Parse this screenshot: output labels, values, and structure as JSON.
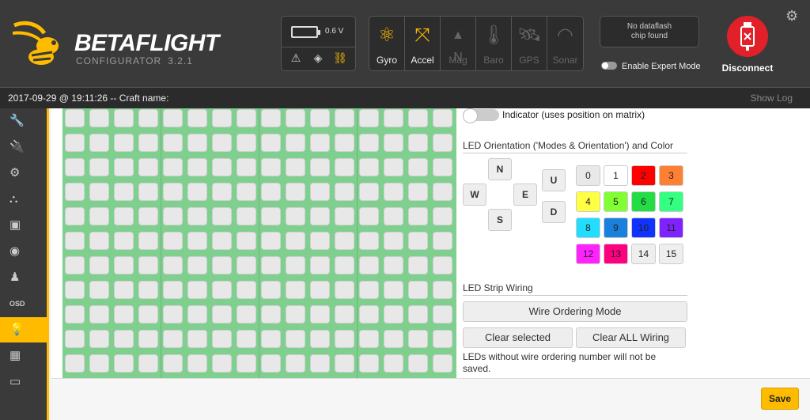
{
  "app": {
    "brand": "BETAFLIGHT",
    "subtitle": "CONFIGURATOR",
    "version": "3.2.1"
  },
  "battery": {
    "voltage": "0.6 V",
    "icons": [
      "warning-icon",
      "diamond-icon",
      "link-icon"
    ]
  },
  "sensors": [
    {
      "label": "Gyro",
      "state": "on"
    },
    {
      "label": "Accel",
      "state": "on"
    },
    {
      "label": "Mag",
      "state": "off"
    },
    {
      "label": "Baro",
      "state": "off"
    },
    {
      "label": "GPS",
      "state": "off"
    },
    {
      "label": "Sonar",
      "state": "off"
    }
  ],
  "dataflash": {
    "line1": "No dataflash",
    "line2": "chip found"
  },
  "expert_mode": {
    "label": "Enable Expert Mode"
  },
  "connection": {
    "disconnect_label": "Disconnect"
  },
  "status": {
    "time_text": "2017-09-29 @ 19:11:26 -- Craft name:",
    "show_log": "Show Log"
  },
  "sidebar": {
    "items": [
      {
        "name": "setup",
        "icon": "wrench-icon"
      },
      {
        "name": "ports",
        "icon": "plug-icon"
      },
      {
        "name": "configuration",
        "icon": "gear-icon"
      },
      {
        "name": "failsafe",
        "icon": "tree-icon"
      },
      {
        "name": "receiver",
        "icon": "robot-icon"
      },
      {
        "name": "modes",
        "icon": "toggle-icon"
      },
      {
        "name": "motors",
        "icon": "motor-icon"
      },
      {
        "name": "osd",
        "icon": "osd-icon"
      },
      {
        "name": "led-strip",
        "icon": "bulb-icon",
        "active": true
      },
      {
        "name": "blackbox",
        "icon": "chip-icon"
      },
      {
        "name": "cli",
        "icon": "terminal-icon"
      }
    ]
  },
  "led_grid": {
    "rows": 11,
    "cols": 16
  },
  "indicator": {
    "label": "Indicator (uses position on matrix)"
  },
  "orientation": {
    "title": "LED Orientation ('Modes & Orientation') and Color",
    "directions": [
      "N",
      "W",
      "E",
      "S",
      "U",
      "D"
    ],
    "colors": [
      {
        "label": "0",
        "hex": "#e8e8e8"
      },
      {
        "label": "1",
        "hex": "#ffffff"
      },
      {
        "label": "2",
        "hex": "#ff0000"
      },
      {
        "label": "3",
        "hex": "#ff8033"
      },
      {
        "label": "4",
        "hex": "#ffff44"
      },
      {
        "label": "5",
        "hex": "#80ff33"
      },
      {
        "label": "6",
        "hex": "#22dd44"
      },
      {
        "label": "7",
        "hex": "#33ff80"
      },
      {
        "label": "8",
        "hex": "#22ddff"
      },
      {
        "label": "9",
        "hex": "#1a80dd"
      },
      {
        "label": "10",
        "hex": "#1133ff"
      },
      {
        "label": "11",
        "hex": "#8022ff"
      },
      {
        "label": "12",
        "hex": "#ff22ff"
      },
      {
        "label": "13",
        "hex": "#ff0080"
      },
      {
        "label": "14",
        "hex": "#eeeeee"
      },
      {
        "label": "15",
        "hex": "#eeeeee"
      }
    ]
  },
  "wiring": {
    "title": "LED Strip Wiring",
    "wire_mode": "Wire Ordering Mode",
    "clear_selected": "Clear selected",
    "clear_all": "Clear ALL Wiring",
    "note": "LEDs without wire ordering number will not be saved."
  },
  "footer": {
    "save": "Save"
  },
  "theme": {
    "accent": "#ffbb00",
    "grid": "#7fcf8f",
    "disconnect": "#e2202a"
  }
}
